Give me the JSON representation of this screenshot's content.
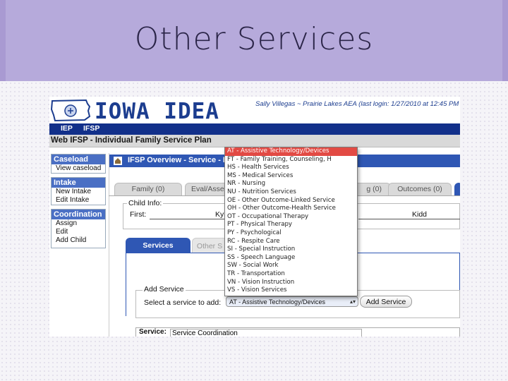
{
  "slide": {
    "title": "Other Services"
  },
  "app": {
    "brand": "IOWA IDEA",
    "user_info": "Sally Villegas ~ Prairie Lakes AEA   (last login: 1/27/2010 at 12:45 PM",
    "nav": [
      "IEP",
      "IFSP"
    ],
    "page_title": "Web IFSP - Individual Family Service Plan"
  },
  "sidebar": {
    "sections": [
      {
        "title": "Caseload",
        "items": [
          "View caseload"
        ]
      },
      {
        "title": "Intake",
        "items": [
          "New Intake",
          "Edit Intake"
        ]
      },
      {
        "title": "Coordination",
        "items": [
          "Assign",
          "Edit",
          "Add Child"
        ]
      }
    ]
  },
  "panel": {
    "header": "IFSP Overview - Service - E",
    "tabs": [
      "Family (0)",
      "Eval/Asses",
      "g (0)",
      "Outcomes (0)"
    ],
    "child_info": {
      "legend": "Child Info:",
      "first_label": "First:",
      "first_value": "Kyl",
      "last_value": "Kidd"
    },
    "service_tabs": [
      "Services",
      "Other S"
    ],
    "add_service": {
      "legend": "Add Service",
      "prompt": "Select a service to add:",
      "selected": "AT - Assistive Technology/Devices",
      "button": "Add Service"
    },
    "service_row": {
      "label": "Service:",
      "value": "Service Coordination"
    }
  },
  "dropdown": {
    "options": [
      "AT - Assistive Technology/Devices",
      "FT - Family Training, Counseling, H",
      "HS - Health Services",
      "MS - Medical Services",
      "NR - Nursing",
      "NU - Nutrition Services",
      "OE - Other Outcome-Linked Service",
      "OH - Other Outcome-Health Service",
      "OT - Occupational Therapy",
      "PT - Physical Therapy",
      "PY - Psychological",
      "RC - Respite Care",
      "SI - Special Instruction",
      "SS - Speech Language",
      "SW - Social Work",
      "TR - Transportation",
      "VN - Vision Instruction",
      "VS - Vision Services"
    ],
    "selected_index": 0
  },
  "colors": {
    "nav": "#12308a",
    "brand": "#1c3d8f",
    "panel_header": "#2f57b4",
    "selection": "#e24a44"
  }
}
